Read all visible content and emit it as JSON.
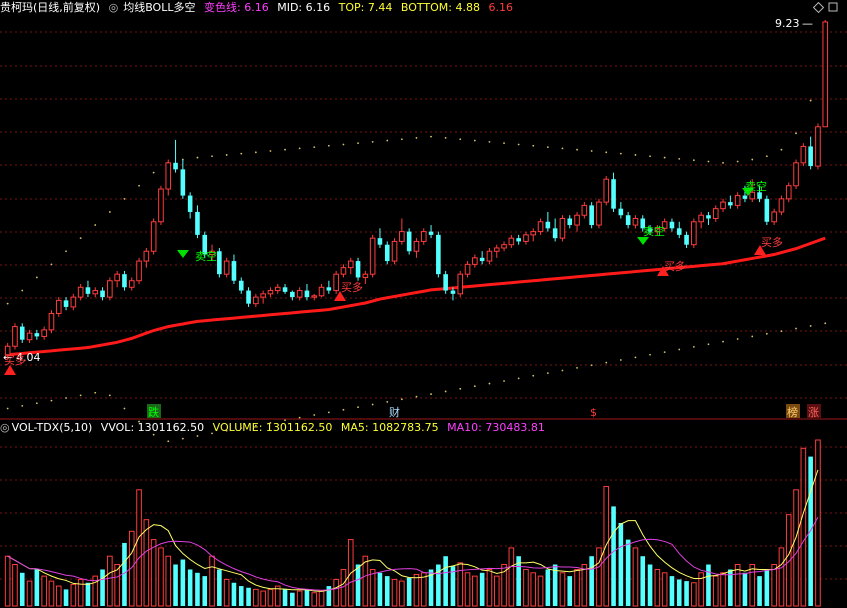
{
  "top_panel": {
    "stock_title": "贵柯玛(日线,前复权)",
    "indicator_name": "均线BOLL多空",
    "change_line_label": "变色线:",
    "change_line_value": "6.16",
    "mid_label": "MID:",
    "mid_value": "6.16",
    "top_label": "TOP:",
    "top_value": "7.44",
    "bottom_label": "BOTTOM:",
    "bottom_value": "4.88",
    "extra_value": "6.16",
    "high_price_label": "9.23",
    "low_price_label": "4.04",
    "signals": [
      "买多",
      "卖空",
      "买多",
      "卖空",
      "买多",
      "买多",
      "卖空",
      "买多"
    ],
    "markers": [
      "跌",
      "财",
      "$",
      "榜",
      "涨"
    ]
  },
  "bottom_panel": {
    "indicator_name": "VOL-TDX(5,10)",
    "vvol_label": "VVOL:",
    "vvol_value": "1301162.50",
    "volume_label": "VOLUME:",
    "volume_value": "1301162.50",
    "ma5_label": "MA5:",
    "ma5_value": "1082783.75",
    "ma10_label": "MA10:",
    "ma10_value": "730483.81"
  },
  "colors": {
    "up": "#ff3c3c",
    "down": "#54ffff",
    "mid_line": "#ff1a1a",
    "boll_band": "#d8c468",
    "grid": "#7a1414",
    "sell_signal": "#00ff00",
    "ma5": "#ffff66",
    "ma10": "#e040e0"
  },
  "chart_data": {
    "type": "candlestick",
    "price_ylim": [
      4.04,
      9.23
    ],
    "ohlc": [
      [
        4.12,
        4.3,
        4.05,
        4.25
      ],
      [
        4.25,
        4.6,
        4.2,
        4.55
      ],
      [
        4.55,
        4.6,
        4.3,
        4.35
      ],
      [
        4.35,
        4.5,
        4.3,
        4.45
      ],
      [
        4.45,
        4.5,
        4.35,
        4.4
      ],
      [
        4.4,
        4.55,
        4.35,
        4.5
      ],
      [
        4.5,
        4.8,
        4.45,
        4.75
      ],
      [
        4.75,
        5.0,
        4.7,
        4.95
      ],
      [
        4.95,
        5.0,
        4.8,
        4.85
      ],
      [
        4.85,
        5.05,
        4.8,
        5.0
      ],
      [
        5.0,
        5.2,
        4.95,
        5.15
      ],
      [
        5.15,
        5.25,
        5.0,
        5.05
      ],
      [
        5.05,
        5.15,
        5.0,
        5.1
      ],
      [
        5.1,
        5.15,
        4.95,
        5.0
      ],
      [
        5.0,
        5.3,
        4.95,
        5.25
      ],
      [
        5.25,
        5.4,
        5.15,
        5.35
      ],
      [
        5.35,
        5.4,
        5.1,
        5.15
      ],
      [
        5.15,
        5.3,
        5.1,
        5.25
      ],
      [
        5.25,
        5.6,
        5.2,
        5.55
      ],
      [
        5.55,
        5.75,
        5.45,
        5.7
      ],
      [
        5.7,
        6.2,
        5.65,
        6.15
      ],
      [
        6.15,
        6.7,
        6.1,
        6.65
      ],
      [
        6.65,
        7.1,
        6.55,
        7.05
      ],
      [
        7.05,
        7.4,
        6.9,
        6.95
      ],
      [
        6.95,
        7.1,
        6.5,
        6.55
      ],
      [
        6.55,
        6.6,
        6.2,
        6.3
      ],
      [
        6.3,
        6.4,
        5.9,
        5.95
      ],
      [
        5.95,
        6.0,
        5.6,
        5.65
      ],
      [
        5.65,
        5.8,
        5.55,
        5.7
      ],
      [
        5.7,
        5.75,
        5.3,
        5.35
      ],
      [
        5.35,
        5.6,
        5.3,
        5.55
      ],
      [
        5.55,
        5.65,
        5.2,
        5.25
      ],
      [
        5.25,
        5.3,
        5.05,
        5.1
      ],
      [
        5.1,
        5.15,
        4.85,
        4.9
      ],
      [
        4.9,
        5.05,
        4.85,
        5.0
      ],
      [
        5.0,
        5.1,
        4.9,
        5.05
      ],
      [
        5.05,
        5.15,
        5.0,
        5.1
      ],
      [
        5.1,
        5.2,
        5.05,
        5.15
      ],
      [
        5.15,
        5.2,
        5.05,
        5.08
      ],
      [
        5.08,
        5.1,
        4.95,
        5.0
      ],
      [
        5.0,
        5.15,
        4.95,
        5.1
      ],
      [
        5.1,
        5.2,
        4.95,
        5.0
      ],
      [
        5.0,
        5.05,
        4.95,
        5.02
      ],
      [
        5.02,
        5.2,
        5.0,
        5.15
      ],
      [
        5.15,
        5.25,
        5.05,
        5.1
      ],
      [
        5.1,
        5.4,
        5.05,
        5.35
      ],
      [
        5.35,
        5.5,
        5.3,
        5.45
      ],
      [
        5.45,
        5.6,
        5.35,
        5.55
      ],
      [
        5.55,
        5.6,
        5.25,
        5.3
      ],
      [
        5.3,
        5.4,
        5.2,
        5.35
      ],
      [
        5.35,
        5.95,
        5.3,
        5.9
      ],
      [
        5.9,
        6.05,
        5.75,
        5.8
      ],
      [
        5.8,
        5.85,
        5.5,
        5.55
      ],
      [
        5.55,
        5.9,
        5.5,
        5.85
      ],
      [
        5.85,
        6.2,
        5.8,
        6.0
      ],
      [
        6.0,
        6.05,
        5.65,
        5.7
      ],
      [
        5.7,
        5.9,
        5.6,
        5.85
      ],
      [
        5.85,
        6.05,
        5.8,
        6.0
      ],
      [
        6.0,
        6.1,
        5.9,
        5.95
      ],
      [
        5.95,
        6.0,
        5.3,
        5.35
      ],
      [
        5.35,
        5.4,
        5.05,
        5.1
      ],
      [
        5.1,
        5.15,
        4.95,
        5.05
      ],
      [
        5.05,
        5.4,
        5.0,
        5.35
      ],
      [
        5.35,
        5.55,
        5.3,
        5.5
      ],
      [
        5.5,
        5.65,
        5.45,
        5.6
      ],
      [
        5.6,
        5.7,
        5.5,
        5.55
      ],
      [
        5.55,
        5.75,
        5.5,
        5.7
      ],
      [
        5.7,
        5.8,
        5.6,
        5.75
      ],
      [
        5.75,
        5.85,
        5.7,
        5.8
      ],
      [
        5.8,
        5.95,
        5.75,
        5.9
      ],
      [
        5.9,
        5.95,
        5.8,
        5.85
      ],
      [
        5.85,
        6.0,
        5.8,
        5.95
      ],
      [
        5.95,
        6.05,
        5.85,
        6.0
      ],
      [
        6.0,
        6.2,
        5.95,
        6.15
      ],
      [
        6.15,
        6.3,
        6.0,
        6.05
      ],
      [
        6.05,
        6.2,
        5.85,
        5.9
      ],
      [
        5.9,
        6.25,
        5.85,
        6.2
      ],
      [
        6.2,
        6.25,
        6.05,
        6.1
      ],
      [
        6.1,
        6.3,
        6.0,
        6.25
      ],
      [
        6.25,
        6.45,
        6.2,
        6.4
      ],
      [
        6.4,
        6.45,
        6.05,
        6.1
      ],
      [
        6.1,
        6.5,
        6.05,
        6.45
      ],
      [
        6.45,
        6.85,
        6.4,
        6.8
      ],
      [
        6.8,
        6.9,
        6.3,
        6.35
      ],
      [
        6.35,
        6.45,
        6.2,
        6.25
      ],
      [
        6.25,
        6.3,
        6.05,
        6.1
      ],
      [
        6.1,
        6.25,
        6.05,
        6.2
      ],
      [
        6.2,
        6.25,
        6.0,
        6.05
      ],
      [
        6.05,
        6.1,
        5.95,
        6.0
      ],
      [
        6.0,
        6.1,
        5.95,
        6.05
      ],
      [
        6.05,
        6.2,
        6.0,
        6.15
      ],
      [
        6.15,
        6.2,
        6.0,
        6.05
      ],
      [
        6.05,
        6.15,
        5.9,
        5.95
      ],
      [
        5.95,
        6.0,
        5.75,
        5.8
      ],
      [
        5.8,
        6.2,
        5.75,
        6.15
      ],
      [
        6.15,
        6.3,
        6.05,
        6.25
      ],
      [
        6.25,
        6.3,
        6.1,
        6.2
      ],
      [
        6.2,
        6.4,
        6.15,
        6.35
      ],
      [
        6.35,
        6.5,
        6.3,
        6.45
      ],
      [
        6.45,
        6.55,
        6.35,
        6.4
      ],
      [
        6.4,
        6.6,
        6.35,
        6.55
      ],
      [
        6.55,
        6.7,
        6.45,
        6.5
      ],
      [
        6.5,
        6.8,
        6.45,
        6.6
      ],
      [
        6.6,
        6.7,
        6.45,
        6.5
      ],
      [
        6.5,
        6.55,
        6.1,
        6.15
      ],
      [
        6.15,
        6.35,
        6.1,
        6.3
      ],
      [
        6.3,
        6.55,
        6.25,
        6.5
      ],
      [
        6.5,
        6.75,
        6.45,
        6.7
      ],
      [
        6.7,
        7.1,
        6.65,
        7.05
      ],
      [
        7.05,
        7.35,
        7.0,
        7.3
      ],
      [
        7.3,
        7.45,
        6.95,
        7.0
      ],
      [
        7.0,
        7.65,
        6.95,
        7.6
      ],
      [
        7.6,
        9.23,
        7.6,
        9.2
      ]
    ],
    "mid_line": [
      4.12,
      4.13,
      4.14,
      4.15,
      4.16,
      4.17,
      4.18,
      4.19,
      4.2,
      4.21,
      4.22,
      4.23,
      4.25,
      4.27,
      4.29,
      4.31,
      4.34,
      4.37,
      4.41,
      4.45,
      4.49,
      4.52,
      4.55,
      4.57,
      4.59,
      4.61,
      4.63,
      4.64,
      4.65,
      4.66,
      4.67,
      4.68,
      4.69,
      4.7,
      4.71,
      4.72,
      4.73,
      4.74,
      4.75,
      4.76,
      4.77,
      4.78,
      4.79,
      4.8,
      4.81,
      4.83,
      4.85,
      4.87,
      4.89,
      4.91,
      4.94,
      4.97,
      4.99,
      5.01,
      5.03,
      5.05,
      5.07,
      5.09,
      5.11,
      5.12,
      5.13,
      5.14,
      5.15,
      5.16,
      5.17,
      5.18,
      5.19,
      5.2,
      5.21,
      5.22,
      5.23,
      5.24,
      5.25,
      5.26,
      5.27,
      5.28,
      5.29,
      5.3,
      5.31,
      5.32,
      5.33,
      5.34,
      5.35,
      5.36,
      5.37,
      5.38,
      5.39,
      5.4,
      5.41,
      5.42,
      5.43,
      5.44,
      5.45,
      5.46,
      5.47,
      5.48,
      5.49,
      5.5,
      5.51,
      5.53,
      5.55,
      5.57,
      5.59,
      5.61,
      5.63,
      5.65,
      5.68,
      5.71,
      5.74,
      5.78,
      5.82,
      5.86,
      5.9
    ],
    "upper_band": [
      4.9,
      5.0,
      5.1,
      5.2,
      5.3,
      5.4,
      5.5,
      5.6,
      5.7,
      5.8,
      5.9,
      6.0,
      6.1,
      6.2,
      6.3,
      6.4,
      6.5,
      6.6,
      6.7,
      6.8,
      6.9,
      7.0,
      7.05,
      7.08,
      7.1,
      7.12,
      7.13,
      7.14,
      7.15,
      7.16,
      7.17,
      7.18,
      7.19,
      7.2,
      7.21,
      7.22,
      7.23,
      7.24,
      7.25,
      7.26,
      7.27,
      7.28,
      7.29,
      7.3,
      7.31,
      7.32,
      7.33,
      7.34,
      7.35,
      7.36,
      7.37,
      7.38,
      7.39,
      7.4,
      7.41,
      7.42,
      7.43,
      7.44,
      7.45,
      7.44,
      7.43,
      7.42,
      7.41,
      7.4,
      7.39,
      7.38,
      7.37,
      7.36,
      7.35,
      7.34,
      7.33,
      7.32,
      7.31,
      7.3,
      7.29,
      7.28,
      7.27,
      7.26,
      7.25,
      7.24,
      7.23,
      7.22,
      7.21,
      7.2,
      7.19,
      7.18,
      7.17,
      7.16,
      7.15,
      7.14,
      7.13,
      7.12,
      7.11,
      7.1,
      7.09,
      7.08,
      7.07,
      7.06,
      7.05,
      7.06,
      7.07,
      7.08,
      7.1,
      7.12,
      7.15,
      7.2,
      7.25,
      7.35,
      7.5,
      7.7,
      8.0,
      8.4,
      8.8
    ],
    "lower_band": [
      3.3,
      3.32,
      3.34,
      3.36,
      3.38,
      3.4,
      3.42,
      3.44,
      3.46,
      3.48,
      3.5,
      3.52,
      3.54,
      3.56,
      3.5,
      3.4,
      3.3,
      3.2,
      3.1,
      3.0,
      2.9,
      2.85,
      2.8,
      2.82,
      2.84,
      2.86,
      2.88,
      2.9,
      2.92,
      2.94,
      2.96,
      2.98,
      3.0,
      3.02,
      3.04,
      3.06,
      3.08,
      3.1,
      3.12,
      3.14,
      3.16,
      3.18,
      3.2,
      3.22,
      3.24,
      3.26,
      3.28,
      3.3,
      3.32,
      3.34,
      3.36,
      3.38,
      3.4,
      3.42,
      3.44,
      3.46,
      3.48,
      3.5,
      3.52,
      3.54,
      3.56,
      3.58,
      3.6,
      3.62,
      3.64,
      3.66,
      3.68,
      3.7,
      3.72,
      3.74,
      3.76,
      3.78,
      3.8,
      3.82,
      3.84,
      3.86,
      3.88,
      3.9,
      3.92,
      3.94,
      3.96,
      3.98,
      4.0,
      4.02,
      4.04,
      4.06,
      4.08,
      4.1,
      4.12,
      4.14,
      4.16,
      4.18,
      4.2,
      4.22,
      4.24,
      4.26,
      4.28,
      4.3,
      4.32,
      4.34,
      4.36,
      4.38,
      4.4,
      4.42,
      4.44,
      4.46,
      4.48,
      4.5,
      4.52,
      4.54,
      4.56,
      4.58,
      4.6
    ],
    "volume": [
      0.3,
      0.25,
      0.2,
      0.15,
      0.22,
      0.18,
      0.15,
      0.12,
      0.1,
      0.13,
      0.16,
      0.14,
      0.18,
      0.22,
      0.3,
      0.25,
      0.38,
      0.45,
      0.7,
      0.52,
      0.4,
      0.35,
      0.3,
      0.25,
      0.28,
      0.22,
      0.2,
      0.18,
      0.3,
      0.22,
      0.16,
      0.14,
      0.12,
      0.11,
      0.1,
      0.09,
      0.1,
      0.12,
      0.1,
      0.08,
      0.09,
      0.1,
      0.08,
      0.09,
      0.12,
      0.16,
      0.22,
      0.4,
      0.25,
      0.3,
      0.22,
      0.2,
      0.18,
      0.16,
      0.15,
      0.17,
      0.19,
      0.2,
      0.22,
      0.25,
      0.3,
      0.24,
      0.26,
      0.2,
      0.18,
      0.2,
      0.22,
      0.18,
      0.25,
      0.35,
      0.3,
      0.22,
      0.2,
      0.18,
      0.22,
      0.25,
      0.2,
      0.18,
      0.22,
      0.25,
      0.3,
      0.35,
      0.72,
      0.6,
      0.5,
      0.4,
      0.35,
      0.3,
      0.25,
      0.22,
      0.2,
      0.18,
      0.16,
      0.15,
      0.14,
      0.2,
      0.25,
      0.18,
      0.2,
      0.22,
      0.25,
      0.2,
      0.25,
      0.18,
      0.22,
      0.25,
      0.35,
      0.55,
      0.7,
      0.95,
      0.9,
      1.0
    ]
  }
}
